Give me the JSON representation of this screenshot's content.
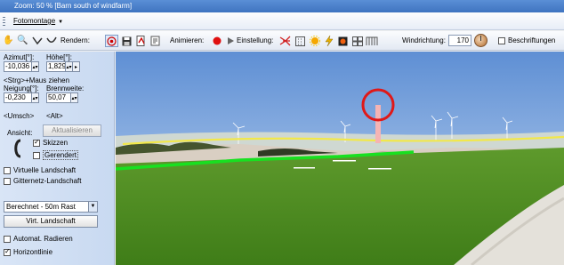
{
  "window": {
    "title": "Zoom: 50 % [Barn south of windfarm]"
  },
  "menu": {
    "item_label": "Fotomontage"
  },
  "toolbar": {
    "render_label": "Rendern:",
    "animate_label": "Animieren:",
    "settings_label": "Einstellung:",
    "wind_direction_label": "Windrichtung:",
    "wind_direction_value": "170",
    "labels_checkbox": "Beschriftungen"
  },
  "sidebar": {
    "azimuth_label": "Azimut[°]:",
    "azimuth_value": "-10,036",
    "height_label": "Höhe[°]:",
    "height_value": "1,829",
    "hint_drag": "<Strg>+Maus ziehen",
    "tilt_label": "Neigung[°]:",
    "tilt_value": "-0,230",
    "focal_label": "Brennweite:",
    "focal_value": "50,07",
    "shift_label": "<Umsch>",
    "alt_label": "<Alt>",
    "view_label": "Ansicht:",
    "refresh_button": "Aktualisieren",
    "sketches_label": "Skizzen",
    "rendered_label": "Gerendert",
    "virtual_landscape_label": "Virtuelle Landschaft",
    "grid_landscape_label": "Gitternetz-Landschaft",
    "grid_select": "Berechnet - 50m Rast",
    "virt_landscape_button": "Virt. Landschaft",
    "auto_render_label": "Automat. Radieren",
    "horizon_line_label": "Horizontlinie"
  },
  "colors": {
    "horizon_line": "#f2e84a",
    "ground_line": "#18e020",
    "marker_circle": "#e01818",
    "marker_pole": "#f5b4b4"
  }
}
